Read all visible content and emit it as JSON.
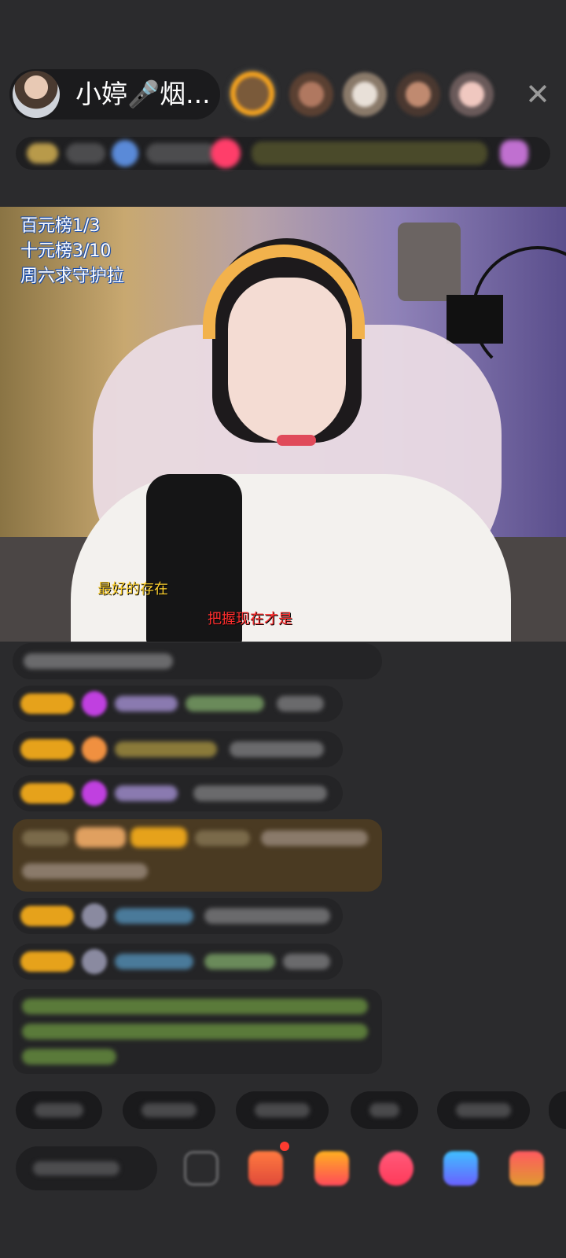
{
  "anchor": {
    "name": "小婷🎤烟...",
    "avatar_icon": "anchor-avatar"
  },
  "top_bar": {
    "viewer_avatars": [
      "viewer-avatar",
      "viewer-avatar",
      "viewer-avatar",
      "viewer-avatar",
      "viewer-avatar"
    ],
    "close_icon": "close-icon",
    "close_glyph": "✕"
  },
  "video": {
    "overlay_lines": [
      "百元榜1/3",
      "十元榜3/10",
      "周六求守护拉"
    ],
    "subtitle_1": "最好的存在",
    "subtitle_2": "把握现在才是"
  },
  "colors": {
    "background": "#2b2b2d",
    "badge_gold": "#e6a21b",
    "overlay_text": "#ffffff",
    "subtitle_yellow": "#ffd230",
    "subtitle_red": "#ff2e2e"
  },
  "chat": {
    "note": "chat messages are blurred/obscured in the screenshot"
  },
  "bottom_bar": {
    "tools": [
      "emoji-icon",
      "gift-box-icon",
      "gift-icon",
      "heart-icon",
      "game-icon",
      "more-icon"
    ]
  }
}
